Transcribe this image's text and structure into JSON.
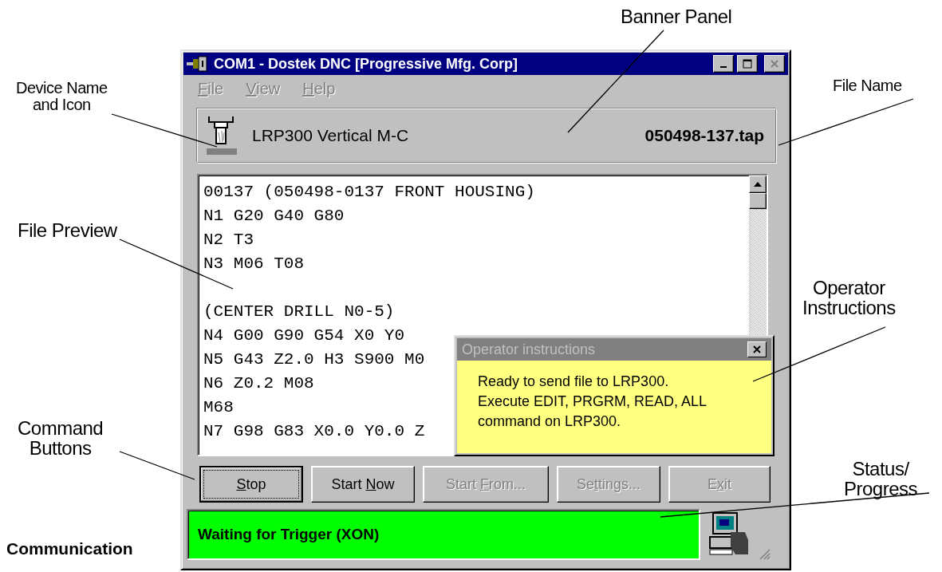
{
  "window": {
    "title": "COM1 - Dostek DNC [Progressive Mfg. Corp]",
    "controls": [
      {
        "kind": "minimize",
        "disabled": false
      },
      {
        "kind": "maximize",
        "disabled": false
      },
      {
        "kind": "close",
        "disabled": true
      }
    ]
  },
  "menu": [
    {
      "parts": [
        {
          "text": "F",
          "underlined": true
        },
        {
          "text": "ile",
          "underlined": false
        }
      ],
      "disabled": true
    },
    {
      "parts": [
        {
          "text": "V",
          "underlined": true
        },
        {
          "text": "iew",
          "underlined": false
        }
      ],
      "disabled": true
    },
    {
      "parts": [
        {
          "text": "H",
          "underlined": true
        },
        {
          "text": "elp",
          "underlined": false
        }
      ],
      "disabled": true
    }
  ],
  "banner": {
    "device_name": "LRP300 Vertical M-C",
    "file_name": "050498-137.tap"
  },
  "preview": {
    "blocks": [
      [
        "00137 (050498-0137 FRONT HOUSING)",
        "N1 G20 G40 G80",
        "N2 T3",
        "N3 M06 T08"
      ],
      [
        "(CENTER DRILL N0-5)",
        "N4 G00 G90 G54 X0 Y0",
        "N5 G43 Z2.0 H3 S900 M0",
        "N6 Z0.2 M08",
        "M68",
        "N7 G98 G83 X0.0 Y0.0 Z"
      ]
    ]
  },
  "operator_dialog": {
    "title": "Operator instructions",
    "message": "Ready to send file to LRP300.\nExecute EDIT, PRGRM, READ, ALL\ncommand on LRP300."
  },
  "buttons": [
    {
      "parts": [
        {
          "text": "S",
          "underlined": true
        },
        {
          "text": "top",
          "underlined": false
        }
      ],
      "disabled": false,
      "focused": true
    },
    {
      "parts": [
        {
          "text": "Start ",
          "underlined": false
        },
        {
          "text": "N",
          "underlined": true
        },
        {
          "text": "ow",
          "underlined": false
        }
      ],
      "disabled": false,
      "focused": false
    },
    {
      "parts": [
        {
          "text": "Start ",
          "underlined": false
        },
        {
          "text": "F",
          "underlined": true
        },
        {
          "text": "rom...",
          "underlined": false
        }
      ],
      "disabled": true,
      "focused": false
    },
    {
      "parts": [
        {
          "text": "Se",
          "underlined": false
        },
        {
          "text": "t",
          "underlined": true
        },
        {
          "text": "tings...",
          "underlined": false
        }
      ],
      "disabled": true,
      "focused": false
    },
    {
      "parts": [
        {
          "text": "E",
          "underlined": false
        },
        {
          "text": "x",
          "underlined": true
        },
        {
          "text": "it",
          "underlined": false
        }
      ],
      "disabled": true,
      "focused": false
    }
  ],
  "status": {
    "text": "Waiting for Trigger (XON)"
  },
  "callouts": [
    {
      "text": "Banner Panel"
    },
    {
      "text": "Device Name\nand Icon"
    },
    {
      "text": "File Name"
    },
    {
      "text": "File Preview"
    },
    {
      "text": "Operator\nInstructions"
    },
    {
      "text": "Command\nButtons"
    },
    {
      "text": "Status/\nProgress"
    }
  ],
  "caption": "Communication"
}
